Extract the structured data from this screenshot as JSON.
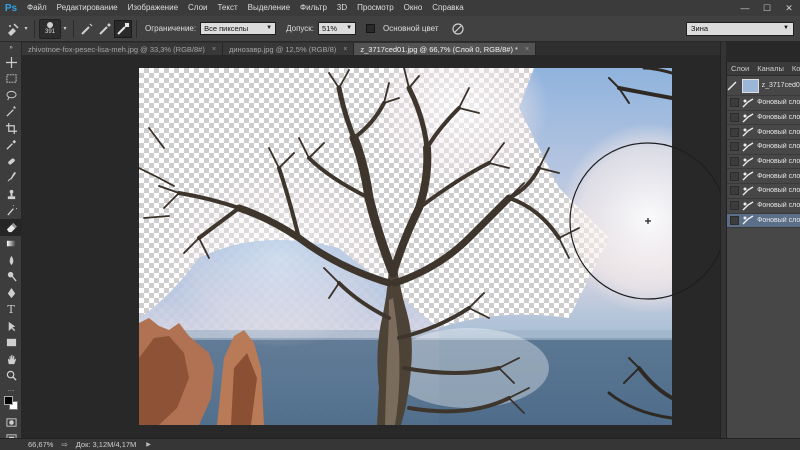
{
  "app": {
    "logo": "Ps",
    "menu": [
      "Файл",
      "Редактирование",
      "Изображение",
      "Слои",
      "Текст",
      "Выделение",
      "Фильтр",
      "3D",
      "Просмотр",
      "Окно",
      "Справка"
    ],
    "window_controls": [
      "—",
      "☐",
      "✕"
    ]
  },
  "options": {
    "brush_size": "391",
    "limit_label": "Ограничение:",
    "limit_value": "Все пикселы",
    "tolerance_label": "Допуск:",
    "tolerance_value": "51%",
    "base_color_label": "Основной цвет",
    "workspace": "Зина"
  },
  "tabs": [
    {
      "label": "zhivotnoe-fox-pesec-lisa-meh.jpg @ 33,3% (RGB/8#)",
      "close": "×"
    },
    {
      "label": "динозавр.jpg @ 12,5% (RGB/8)",
      "close": "×"
    },
    {
      "label": "z_3717ced01.jpg @ 66,7% (Слой 0, RGB/8#) *",
      "close": "×"
    }
  ],
  "layers_panel": {
    "tabs": [
      "Слои",
      "Каналы",
      "Конт"
    ],
    "top_layer_name": "z_3717ced01",
    "layers": [
      "Фоновый слой",
      "Фоновый слой",
      "Фоновый слой",
      "Фоновый слой",
      "Фоновый слой",
      "Фоновый слой",
      "Фоновый слой",
      "Фоновый слой",
      "Фоновый слой"
    ]
  },
  "status": {
    "zoom": "66,67%",
    "doc_info": "Док: 3,12M/4,17M"
  },
  "watermark_text": "3!",
  "colors": {
    "accent": "#2fa3e6",
    "selected_layer": "#5b6f89",
    "foreground": "#000000",
    "background": "#ffffff"
  }
}
